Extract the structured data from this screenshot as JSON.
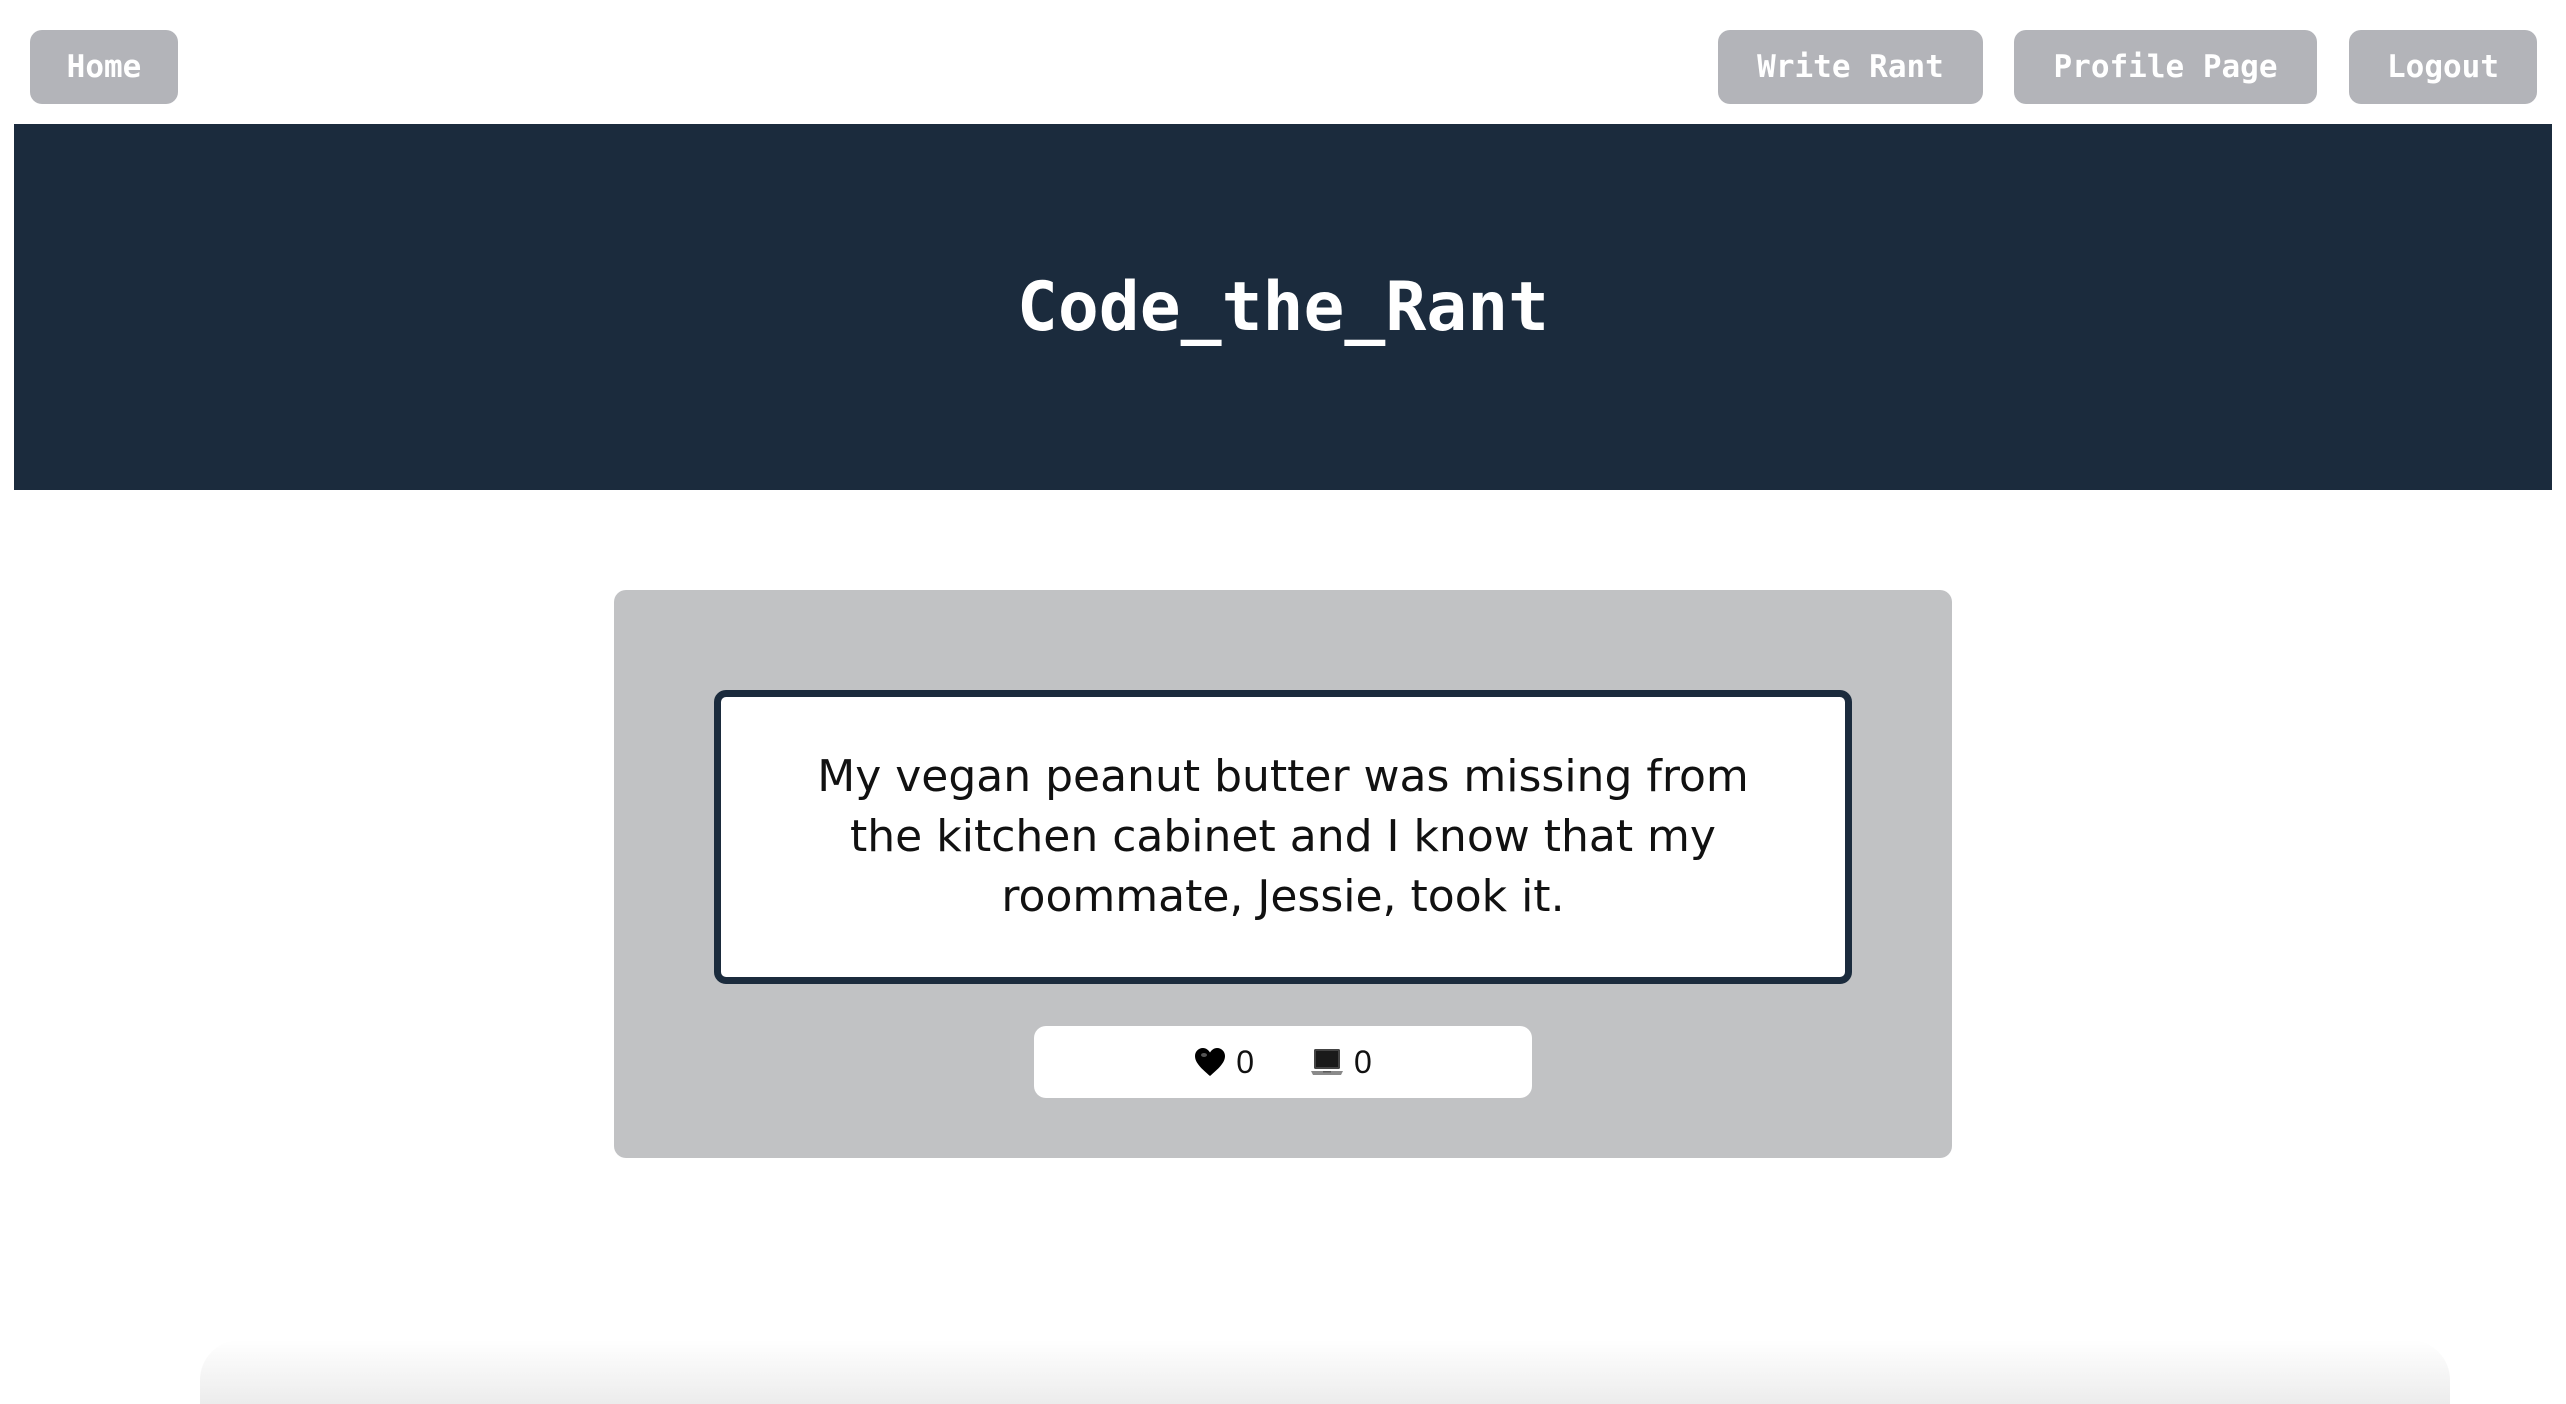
{
  "nav": {
    "home_label": "Home",
    "write_label": "Write Rant",
    "profile_label": "Profile Page",
    "logout_label": "Logout"
  },
  "header": {
    "title": "Code_the_Rant"
  },
  "rant": {
    "text": "My vegan peanut butter was missing from the kitchen cabinet and I know that my roommate, Jessie, took it.",
    "likes": "0",
    "comments": "0",
    "like_icon": "heart-icon",
    "comment_icon": "laptop-icon"
  },
  "colors": {
    "header_bg": "#1b2b3d",
    "nav_button_bg": "#b3b4b9",
    "card_bg": "#c1c2c4"
  }
}
